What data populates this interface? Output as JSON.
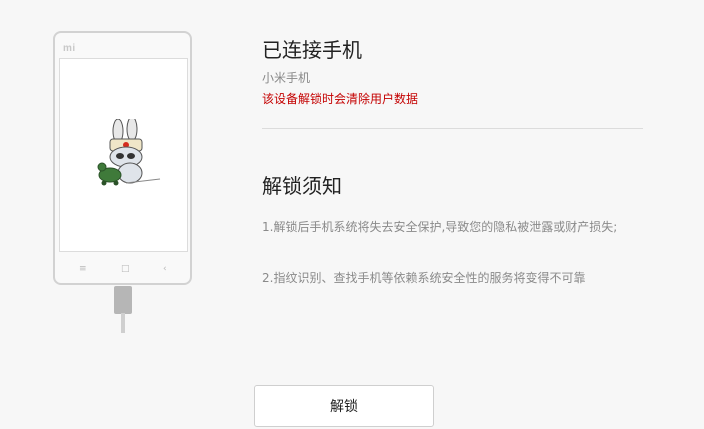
{
  "phone": {
    "logo": "mi",
    "nav_icons": [
      "menu-icon",
      "home-icon",
      "back-icon"
    ],
    "nav_glyphs": {
      "menu": "≡",
      "home": "□",
      "back": "‹"
    },
    "mascot": "mitu-bunny-icon"
  },
  "status": {
    "title": "已连接手机",
    "device_name": "小米手机",
    "warning": "该设备解锁时会清除用户数据"
  },
  "notice": {
    "title": "解锁须知",
    "items": [
      "1.解锁后手机系统将失去安全保护,导致您的隐私被泄露或财产损失;",
      "2.指纹识别、查找手机等依赖系统安全性的服务将变得不可靠"
    ]
  },
  "actions": {
    "unlock_label": "解锁"
  },
  "colors": {
    "warning": "#c40000",
    "background": "#f7f7f7",
    "divider": "#dcdcdc"
  }
}
